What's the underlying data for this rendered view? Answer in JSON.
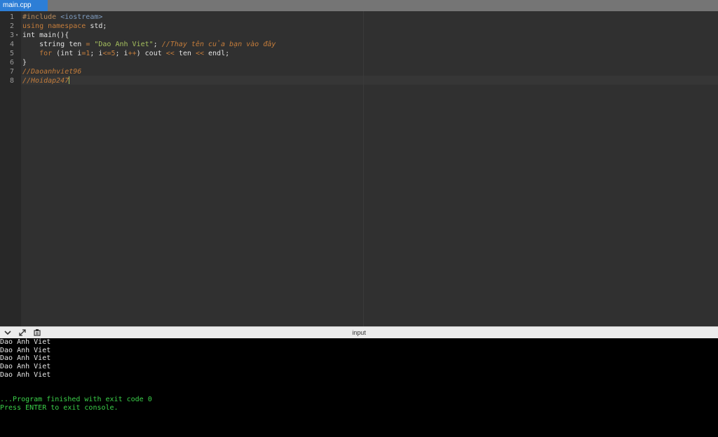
{
  "tab": {
    "label": "main.cpp"
  },
  "editor": {
    "lines": [
      {
        "n": "1",
        "tokens": [
          {
            "c": "t-pre",
            "t": "#include "
          },
          {
            "c": "t-hdr",
            "t": "<iostream>"
          }
        ]
      },
      {
        "n": "2",
        "tokens": [
          {
            "c": "t-kw",
            "t": "using namespace"
          },
          {
            "c": "t-plain",
            "t": " std;"
          }
        ]
      },
      {
        "n": "3",
        "fold": "▾",
        "tokens": [
          {
            "c": "t-plain",
            "t": "int main(){"
          }
        ]
      },
      {
        "n": "4",
        "tokens": [
          {
            "c": "t-plain",
            "t": "    string ten "
          },
          {
            "c": "t-op",
            "t": "="
          },
          {
            "c": "t-plain",
            "t": " "
          },
          {
            "c": "t-str",
            "t": "\"Dao Anh Viet\""
          },
          {
            "c": "t-plain",
            "t": "; "
          },
          {
            "c": "t-cmt",
            "t": "//Thay tên của bạn vào đây"
          }
        ]
      },
      {
        "n": "5",
        "tokens": [
          {
            "c": "t-plain",
            "t": "    "
          },
          {
            "c": "t-kw",
            "t": "for"
          },
          {
            "c": "t-plain",
            "t": " (int i"
          },
          {
            "c": "t-op",
            "t": "="
          },
          {
            "c": "t-num",
            "t": "1"
          },
          {
            "c": "t-plain",
            "t": "; i"
          },
          {
            "c": "t-op",
            "t": "<="
          },
          {
            "c": "t-num",
            "t": "5"
          },
          {
            "c": "t-plain",
            "t": "; i"
          },
          {
            "c": "t-op",
            "t": "++"
          },
          {
            "c": "t-plain",
            "t": ") cout "
          },
          {
            "c": "t-op",
            "t": "<<"
          },
          {
            "c": "t-plain",
            "t": " ten "
          },
          {
            "c": "t-op",
            "t": "<<"
          },
          {
            "c": "t-plain",
            "t": " endl;"
          }
        ]
      },
      {
        "n": "6",
        "tokens": [
          {
            "c": "t-plain",
            "t": "}"
          }
        ]
      },
      {
        "n": "7",
        "tokens": [
          {
            "c": "t-cmt",
            "t": "//Daoanhviet96"
          }
        ]
      },
      {
        "n": "8",
        "tokens": [
          {
            "c": "t-cmt",
            "t": "//Hoidap247"
          }
        ],
        "cursor": true
      }
    ]
  },
  "console_bar": {
    "title": "input",
    "icons": [
      "chevron-down-icon",
      "expand-icon",
      "settings-icon"
    ]
  },
  "console": {
    "output": [
      {
        "text": "Dao Anh Viet",
        "color": "white"
      },
      {
        "text": "Dao Anh Viet",
        "color": "white"
      },
      {
        "text": "Dao Anh Viet",
        "color": "white"
      },
      {
        "text": "Dao Anh Viet",
        "color": "white"
      },
      {
        "text": "Dao Anh Viet",
        "color": "white"
      },
      {
        "text": "",
        "color": "white"
      },
      {
        "text": "",
        "color": "white"
      },
      {
        "text": "...Program finished with exit code 0",
        "color": "green"
      },
      {
        "text": "Press ENTER to exit console.",
        "color": "green"
      }
    ]
  }
}
